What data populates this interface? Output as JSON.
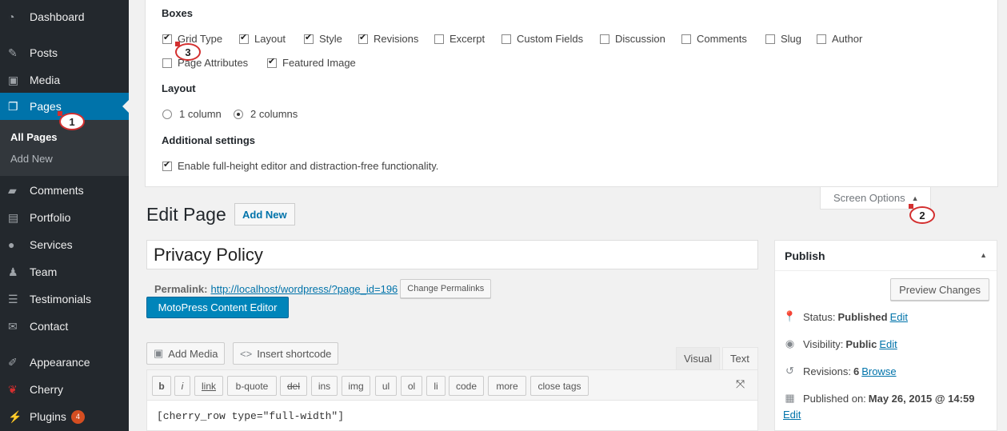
{
  "sidebar": {
    "items": [
      {
        "icon": "dashboard-icon",
        "label": "Dashboard"
      },
      {
        "icon": "pin-icon",
        "label": "Posts"
      },
      {
        "icon": "media-icon",
        "label": "Media"
      },
      {
        "icon": "pages-icon",
        "label": "Pages"
      },
      {
        "icon": "comments-icon",
        "label": "Comments"
      },
      {
        "icon": "portfolio-icon",
        "label": "Portfolio"
      },
      {
        "icon": "lightbulb-icon",
        "label": "Services"
      },
      {
        "icon": "team-icon",
        "label": "Team"
      },
      {
        "icon": "testimonials-icon",
        "label": "Testimonials"
      },
      {
        "icon": "envelope-icon",
        "label": "Contact"
      },
      {
        "icon": "brush-icon",
        "label": "Appearance"
      },
      {
        "icon": "cherry-icon",
        "label": "Cherry"
      },
      {
        "icon": "plug-icon",
        "label": "Plugins"
      }
    ],
    "submenu": [
      "All Pages",
      "Add New"
    ],
    "plugins_badge": "4",
    "accent": "#0073aa"
  },
  "screen_options": {
    "boxes_heading": "Boxes",
    "boxes": [
      {
        "label": "Grid Type",
        "checked": true
      },
      {
        "label": "Layout",
        "checked": true
      },
      {
        "label": "Style",
        "checked": true
      },
      {
        "label": "Revisions",
        "checked": true
      },
      {
        "label": "Excerpt",
        "checked": false
      },
      {
        "label": "Custom Fields",
        "checked": false
      },
      {
        "label": "Discussion",
        "checked": false
      },
      {
        "label": "Comments",
        "checked": false
      },
      {
        "label": "Slug",
        "checked": false
      },
      {
        "label": "Author",
        "checked": false
      },
      {
        "label": "Page Attributes",
        "checked": false
      },
      {
        "label": "Featured Image",
        "checked": true
      }
    ],
    "layout_heading": "Layout",
    "layout_options": [
      "1 column",
      "2 columns"
    ],
    "layout_selected": "2 columns",
    "additional_heading": "Additional settings",
    "additional_option": "Enable full-height editor and distraction-free functionality.",
    "additional_checked": true,
    "tab_label": "Screen Options"
  },
  "callouts": [
    "1",
    "2",
    "3"
  ],
  "editor": {
    "page_title": "Edit Page",
    "add_new": "Add New",
    "title_value": "Privacy Policy",
    "permalink_label": "Permalink:",
    "permalink_url": "http://localhost/wordpress/?page_id=196",
    "change_permalinks": "Change Permalinks",
    "motopress_button": "MotoPress Content Editor",
    "add_media": "Add Media",
    "insert_shortcode": "Insert shortcode",
    "tab_visual": "Visual",
    "tab_text": "Text",
    "quicktags": [
      "b",
      "i",
      "link",
      "b-quote",
      "del",
      "ins",
      "img",
      "ul",
      "ol",
      "li",
      "code",
      "more",
      "close tags"
    ],
    "content": "[cherry_row type=\"full-width\"]"
  },
  "publish": {
    "heading": "Publish",
    "preview": "Preview Changes",
    "status_label": "Status:",
    "status_value": "Published",
    "visibility_label": "Visibility:",
    "visibility_value": "Public",
    "revisions_label": "Revisions:",
    "revisions_value": "6",
    "browse": "Browse",
    "published_label": "Published on:",
    "published_value": "May 26, 2015 @ 14:59",
    "edit": "Edit"
  }
}
